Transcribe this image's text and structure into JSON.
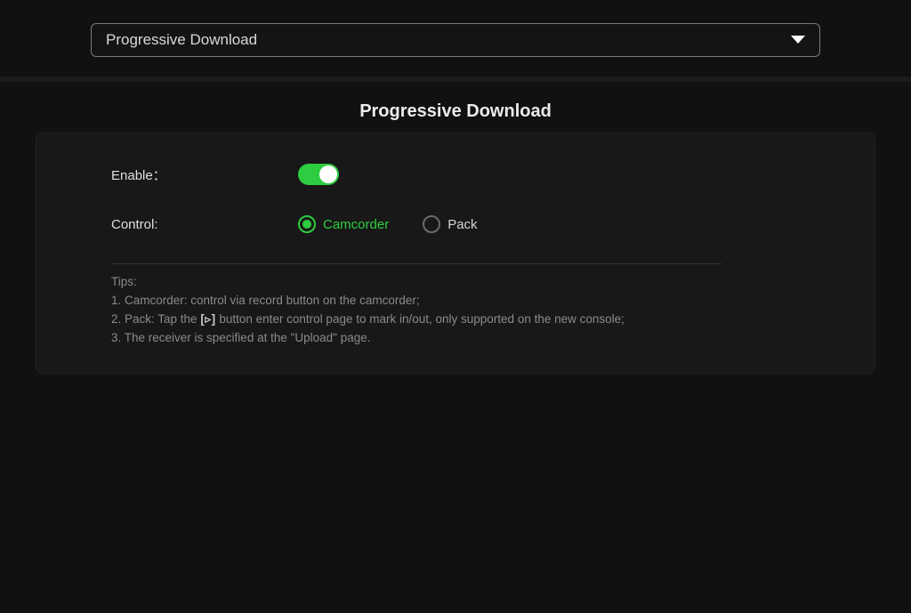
{
  "topSelect": {
    "value": "Progressive Download"
  },
  "title": "Progressive Download",
  "form": {
    "enableLabel": "Enable：",
    "controlLabel": "Control:",
    "controlOptions": {
      "camcorder": "Camcorder",
      "pack": "Pack"
    }
  },
  "tips": {
    "header": "Tips:",
    "line1": "1. Camcorder: control via record button on the camcorder;",
    "line2_pre": "2. Pack: Tap the ",
    "line2_bracket": "[▹]",
    "line2_post": " button enter control page to mark in/out, only supported on the new console;",
    "line3": "3. The receiver is specified at the \"Upload\" page."
  }
}
